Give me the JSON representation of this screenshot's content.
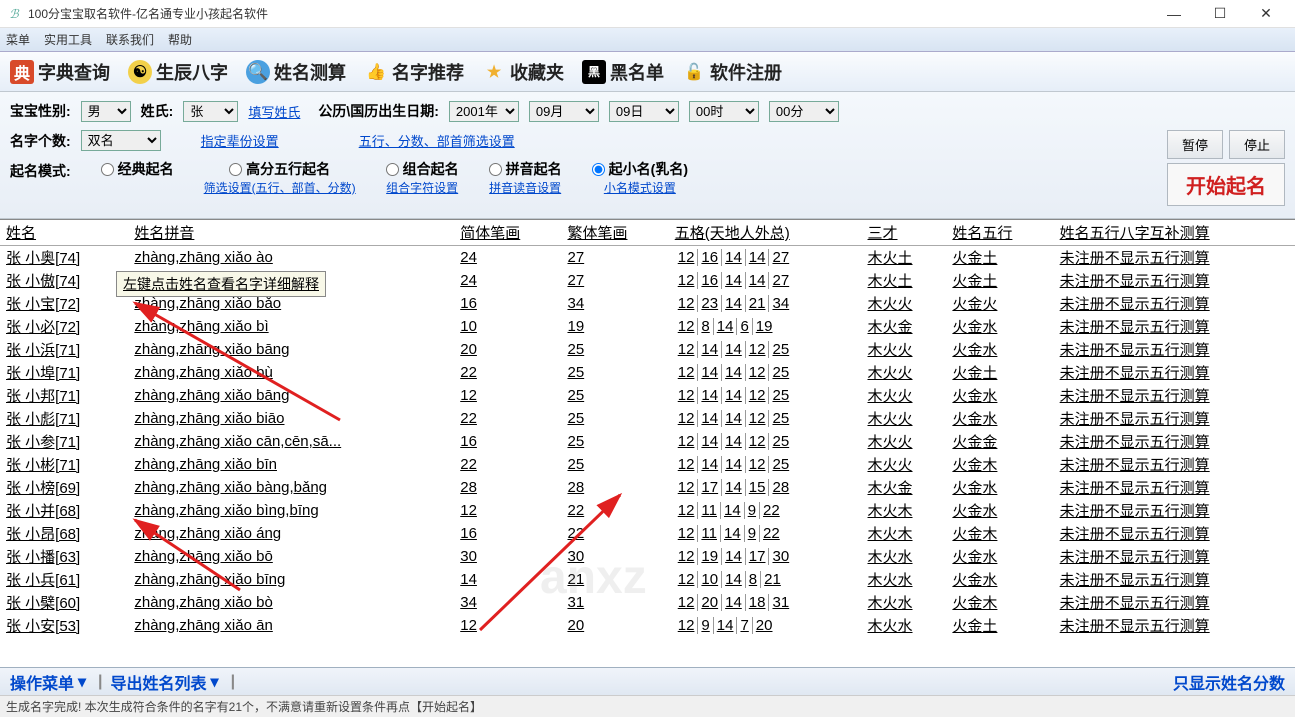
{
  "window": {
    "title": "100分宝宝取名软件-亿名通专业小孩起名软件"
  },
  "menubar": {
    "items": [
      "菜单",
      "实用工具",
      "联系我们",
      "帮助"
    ]
  },
  "toolbar": {
    "dict": "字典查询",
    "bazi": "生辰八字",
    "cesuan": "姓名测算",
    "tuijian": "名字推荐",
    "fav": "收藏夹",
    "blacklist": "黑名单",
    "reg": "软件注册"
  },
  "controls": {
    "gender_label": "宝宝性别:",
    "gender_value": "男",
    "surname_label": "姓氏:",
    "surname_value": "张",
    "surname_link": "填写姓氏",
    "birth_label": "公历\\国历出生日期:",
    "year": "2001年",
    "month": "09月",
    "day": "09日",
    "hour": "00时",
    "minute": "00分",
    "count_label": "名字个数:",
    "count_value": "双名",
    "bei_link": "指定辈份设置",
    "filter_link": "五行、分数、部首筛选设置",
    "mode_label": "起名模式:",
    "modes": {
      "classic": "经典起名",
      "high": "高分五行起名",
      "high_sub": "筛选设置(五行、部首、分数)",
      "combo": "组合起名",
      "combo_sub": "组合字符设置",
      "pinyin": "拼音起名",
      "pinyin_sub": "拼音读音设置",
      "nick": "起小名(乳名)",
      "nick_sub": "小名模式设置"
    },
    "pause": "暂停",
    "stop": "停止",
    "start": "开始起名"
  },
  "tooltip": "左键点击姓名查看名字详细解释",
  "headers": {
    "name": "姓名",
    "pinyin": "姓名拼音",
    "simp": "简体笔画",
    "trad": "繁体笔画",
    "wuge": "五格(天地人外总)",
    "sancai": "三才",
    "wuxing": "姓名五行",
    "comp": "姓名五行八字互补测算"
  },
  "rows": [
    {
      "name": "张 小奥[74]",
      "pinyin": "zhàng,zhāng xiǎo ào",
      "simp": "24",
      "trad": "27",
      "wuge": [
        "12",
        "16",
        "14",
        "14",
        "27"
      ],
      "sancai": "木火土",
      "wx": "火金土",
      "comp": "未注册不显示五行测算"
    },
    {
      "name": "张 小傲[74]",
      "pinyin": "",
      "simp": "24",
      "trad": "27",
      "wuge": [
        "12",
        "16",
        "14",
        "14",
        "27"
      ],
      "sancai": "木火土",
      "wx": "火金土",
      "comp": "未注册不显示五行测算"
    },
    {
      "name": "张 小宝[72]",
      "pinyin": "zhàng,zhāng xiǎo bǎo",
      "simp": "16",
      "trad": "34",
      "wuge": [
        "12",
        "23",
        "14",
        "21",
        "34"
      ],
      "sancai": "木火火",
      "wx": "火金火",
      "comp": "未注册不显示五行测算"
    },
    {
      "name": "张 小必[72]",
      "pinyin": "zhàng,zhāng xiǎo bì",
      "simp": "10",
      "trad": "19",
      "wuge": [
        "12",
        "8",
        "14",
        "6",
        "19"
      ],
      "sancai": "木火金",
      "wx": "火金水",
      "comp": "未注册不显示五行测算"
    },
    {
      "name": "张 小浜[71]",
      "pinyin": "zhàng,zhāng xiǎo bāng",
      "simp": "20",
      "trad": "25",
      "wuge": [
        "12",
        "14",
        "14",
        "12",
        "25"
      ],
      "sancai": "木火火",
      "wx": "火金水",
      "comp": "未注册不显示五行测算"
    },
    {
      "name": "张 小埠[71]",
      "pinyin": "zhàng,zhāng xiǎo bù",
      "simp": "22",
      "trad": "25",
      "wuge": [
        "12",
        "14",
        "14",
        "12",
        "25"
      ],
      "sancai": "木火火",
      "wx": "火金土",
      "comp": "未注册不显示五行测算"
    },
    {
      "name": "张 小邦[71]",
      "pinyin": "zhàng,zhāng xiǎo bāng",
      "simp": "12",
      "trad": "25",
      "wuge": [
        "12",
        "14",
        "14",
        "12",
        "25"
      ],
      "sancai": "木火火",
      "wx": "火金水",
      "comp": "未注册不显示五行测算"
    },
    {
      "name": "张 小彪[71]",
      "pinyin": "zhàng,zhāng xiǎo biāo",
      "simp": "22",
      "trad": "25",
      "wuge": [
        "12",
        "14",
        "14",
        "12",
        "25"
      ],
      "sancai": "木火火",
      "wx": "火金水",
      "comp": "未注册不显示五行测算"
    },
    {
      "name": "张 小参[71]",
      "pinyin": "zhàng,zhāng xiǎo cān,cēn,sā...",
      "simp": "16",
      "trad": "25",
      "wuge": [
        "12",
        "14",
        "14",
        "12",
        "25"
      ],
      "sancai": "木火火",
      "wx": "火金金",
      "comp": "未注册不显示五行测算"
    },
    {
      "name": "张 小彬[71]",
      "pinyin": "zhàng,zhāng xiǎo bīn",
      "simp": "22",
      "trad": "25",
      "wuge": [
        "12",
        "14",
        "14",
        "12",
        "25"
      ],
      "sancai": "木火火",
      "wx": "火金木",
      "comp": "未注册不显示五行测算"
    },
    {
      "name": "张 小榜[69]",
      "pinyin": "zhàng,zhāng xiǎo bàng,bǎng",
      "simp": "28",
      "trad": "28",
      "wuge": [
        "12",
        "17",
        "14",
        "15",
        "28"
      ],
      "sancai": "木火金",
      "wx": "火金水",
      "comp": "未注册不显示五行测算"
    },
    {
      "name": "张 小并[68]",
      "pinyin": "zhàng,zhāng xiǎo bìng,bīng",
      "simp": "12",
      "trad": "22",
      "wuge": [
        "12",
        "11",
        "14",
        "9",
        "22"
      ],
      "sancai": "木火木",
      "wx": "火金水",
      "comp": "未注册不显示五行测算"
    },
    {
      "name": "张 小昂[68]",
      "pinyin": "zhàng,zhāng xiǎo áng",
      "simp": "16",
      "trad": "22",
      "wuge": [
        "12",
        "11",
        "14",
        "9",
        "22"
      ],
      "sancai": "木火木",
      "wx": "火金木",
      "comp": "未注册不显示五行测算"
    },
    {
      "name": "张 小播[63]",
      "pinyin": "zhàng,zhāng xiǎo bō",
      "simp": "30",
      "trad": "30",
      "wuge": [
        "12",
        "19",
        "14",
        "17",
        "30"
      ],
      "sancai": "木火水",
      "wx": "火金水",
      "comp": "未注册不显示五行测算"
    },
    {
      "name": "张 小兵[61]",
      "pinyin": "zhàng,zhāng xiǎo bīng",
      "simp": "14",
      "trad": "21",
      "wuge": [
        "12",
        "10",
        "14",
        "8",
        "21"
      ],
      "sancai": "木火水",
      "wx": "火金水",
      "comp": "未注册不显示五行测算"
    },
    {
      "name": "张 小檗[60]",
      "pinyin": "zhàng,zhāng xiǎo bò",
      "simp": "34",
      "trad": "31",
      "wuge": [
        "12",
        "20",
        "14",
        "18",
        "31"
      ],
      "sancai": "木火水",
      "wx": "火金木",
      "comp": "未注册不显示五行测算"
    },
    {
      "name": "张 小安[53]",
      "pinyin": "zhàng,zhāng xiǎo ān",
      "simp": "12",
      "trad": "20",
      "wuge": [
        "12",
        "9",
        "14",
        "7",
        "20"
      ],
      "sancai": "木火水",
      "wx": "火金土",
      "comp": "未注册不显示五行测算"
    }
  ],
  "bottombar": {
    "menu": "操作菜单",
    "export": "导出姓名列表",
    "right": "只显示姓名分数"
  },
  "statusbar": {
    "text": "生成名字完成! 本次生成符合条件的名字有21个，不满意请重新设置条件再点【开始起名】"
  }
}
